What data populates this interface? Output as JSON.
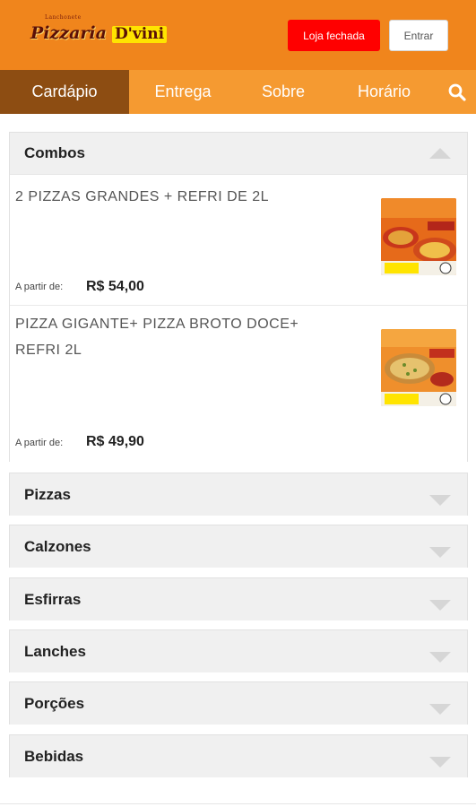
{
  "header": {
    "logo_sub": "Lanchonete",
    "logo_main": "Pizzaria",
    "logo_brand": "D'vini",
    "store_status": "Loja fechada",
    "login_label": "Entrar"
  },
  "nav": {
    "tabs": [
      {
        "label": "Cardápio",
        "active": true
      },
      {
        "label": "Entrega",
        "active": false
      },
      {
        "label": "Sobre",
        "active": false
      },
      {
        "label": "Horário",
        "active": false
      }
    ],
    "search_icon": "search-icon"
  },
  "menu": {
    "sections": [
      {
        "title": "Combos",
        "expanded": true
      },
      {
        "title": "Pizzas",
        "expanded": false
      },
      {
        "title": "Calzones",
        "expanded": false
      },
      {
        "title": "Esfirras",
        "expanded": false
      },
      {
        "title": "Lanches",
        "expanded": false
      },
      {
        "title": "Porções",
        "expanded": false
      },
      {
        "title": "Bebidas",
        "expanded": false
      }
    ],
    "combos": [
      {
        "name": "2 PIZZAS GRANDES + REFRI DE 2L",
        "price_label": "A partir de:",
        "price": "R$ 54,00",
        "thumb_lines": [
          "2 PIZZAS GRANDES",
          "+ REFRI DE 2 LITROS",
          "R$ 54,00",
          "D'vini"
        ]
      },
      {
        "name": "PIZZA GIGANTE+ PIZZA BROTO DOCE+ REFRI 2L",
        "price_label": "A partir de:",
        "price": "R$ 49,90",
        "thumb_lines": [
          "PIZZA GIGANTE + PIZZA BROTO DOCE +",
          "REFRI 2L",
          "R$ 49,90",
          "D'vini"
        ]
      }
    ]
  },
  "colors": {
    "topbar": "#f0851c",
    "navbar": "#f59a31",
    "nav_active": "#8d4d12",
    "closed_button": "#ff0000"
  }
}
